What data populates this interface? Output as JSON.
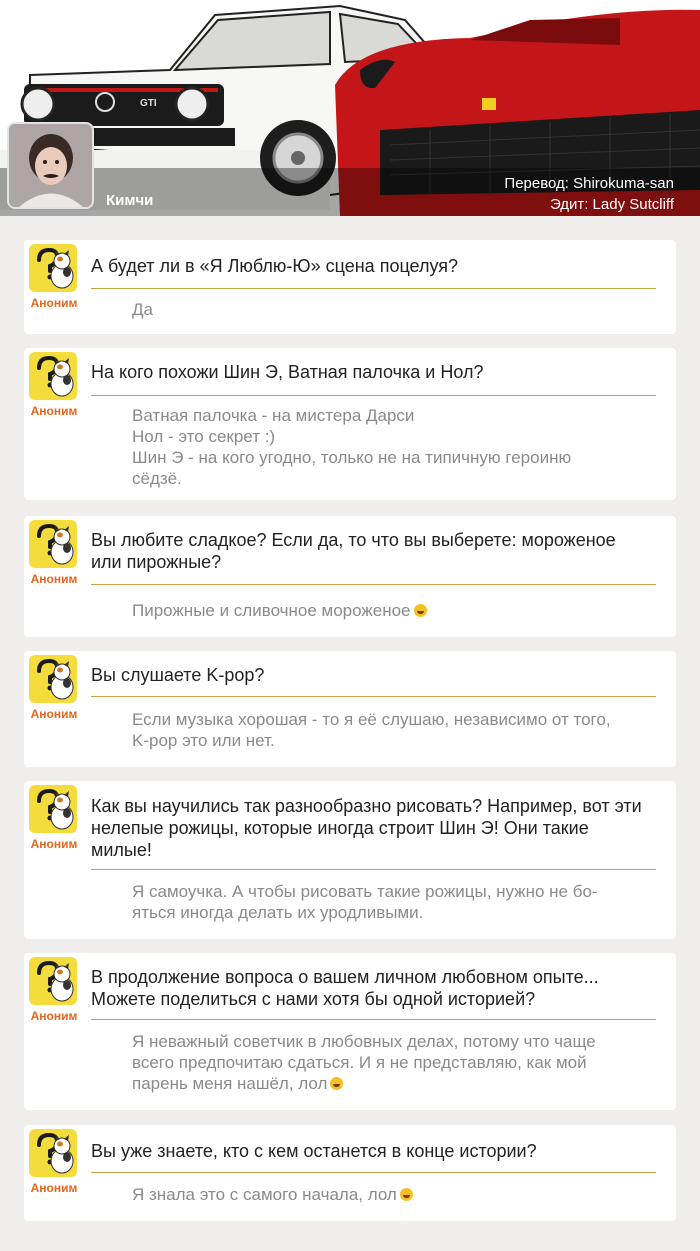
{
  "header": {
    "author": "Кимчи",
    "credit_translate": "Перевод: Shirokuma-san",
    "credit_edit": "Эдит: Lady Sutcliff"
  },
  "colors": {
    "background": "#efeeec",
    "anon_label": "#e0671f",
    "avatar_bg": "#f4dc3c",
    "separator": "#c8a243",
    "answer_text": "#8a8a8a",
    "car_red": "#c41618"
  },
  "icons": [
    "cat-avatar-icon",
    "laughing-emoji-icon"
  ],
  "qa": [
    {
      "user": "Аноним",
      "question": "А будет ли в «Я Люблю-Ю» сцена поцелуя?",
      "answer": "Да"
    },
    {
      "user": "Аноним",
      "question": "На кого похожи Шин Э, Ватная палочка и Нол?",
      "answer_lines": [
        "Ватная палочка - на мистера Дарси",
        "Нол - это секрет :)",
        "Шин Э - на кого угодно, только не на типичную героиню",
        "сёдзё."
      ]
    },
    {
      "user": "Аноним",
      "question_lines": [
        "Вы любите сладкое? Если да, то что вы выберете: мороженое",
        "или пирожные?"
      ],
      "answer": "Пирожные и сливочное мороженое"
    },
    {
      "user": "Аноним",
      "question": "Вы слушаете K-pop?",
      "answer_lines": [
        "Если музыка хорошая - то я её слушаю, независимо от того,",
        "K-pop это или нет."
      ]
    },
    {
      "user": "Аноним",
      "question_lines": [
        "Как вы научились так разнообразно рисовать? Например, вот эти",
        "нелепые рожицы, которые иногда строит Шин Э! Они такие",
        "милые!"
      ],
      "answer_lines": [
        "Я самоучка. А чтобы рисовать такие рожицы, нужно не бо-",
        "яться иногда делать их уродливыми."
      ]
    },
    {
      "user": "Аноним",
      "question_lines": [
        "В продолжение вопроса о вашем личном любовном опыте...",
        "Можете поделиться с нами хотя бы одной историей?"
      ],
      "answer_lines": [
        "Я неважный советчик в любовных делах, потому что чаще",
        "всего предпочитаю сдаться. И я не представляю, как мой",
        "парень меня нашёл, лол"
      ]
    },
    {
      "user": "Аноним",
      "question": "Вы уже знаете, кто с кем останется в конце истории?",
      "answer": "Я знала это с самого начала, лол"
    }
  ]
}
